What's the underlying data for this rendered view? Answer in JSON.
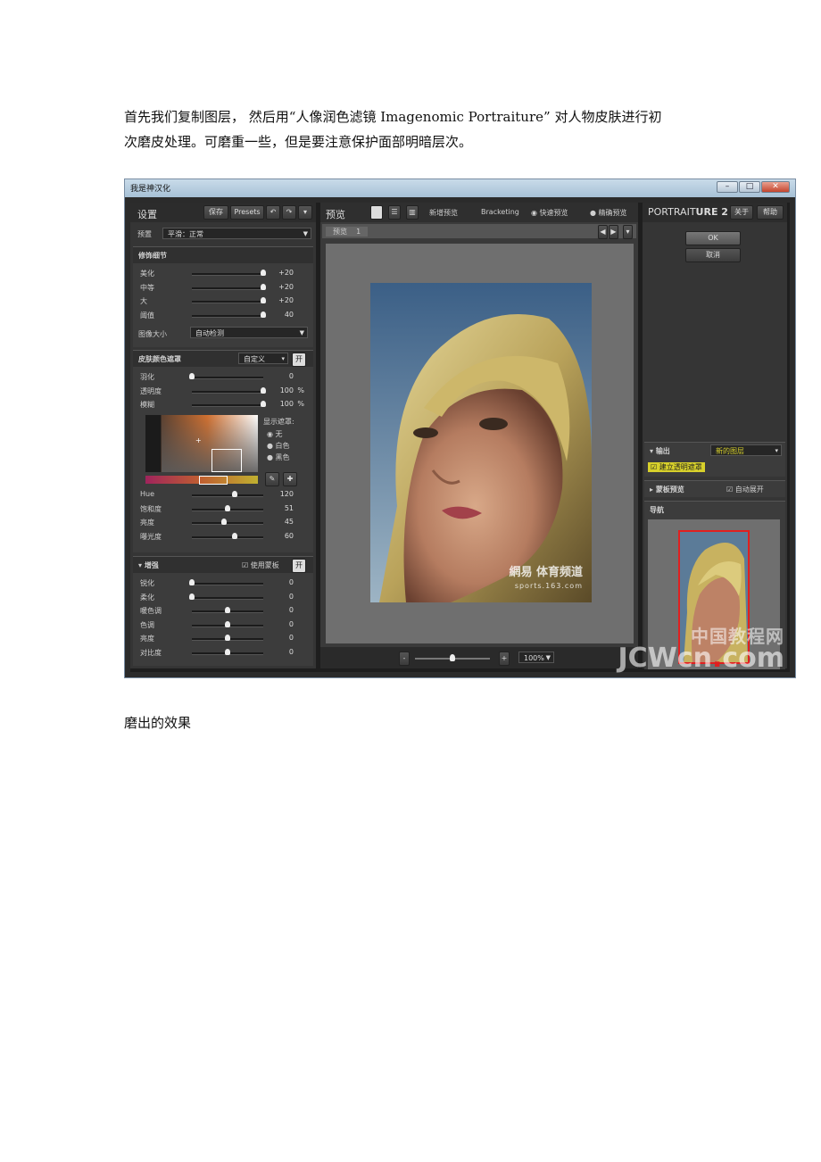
{
  "intro": {
    "line1": "首先我们复制图层， 然后用“人像润色滤镜 Imagenomic Portraiture” 对人物皮肤进行初",
    "line2": "次磨皮处理。可磨重一些，但是要注意保护面部明暗层次。"
  },
  "caption": "磨出的效果",
  "window": {
    "title": "我是神汉化",
    "controls": {
      "minimize": "–",
      "maximize": "□",
      "close": "✕"
    }
  },
  "settings": {
    "title": "设置",
    "save": "保存",
    "presets": "Presets",
    "undo_icon": "undo-icon",
    "redo_icon": "redo-icon",
    "preset_label": "预置",
    "preset_value": "平滑：正常",
    "detail": {
      "title": "修饰细节",
      "rows": [
        {
          "name": "美化",
          "value": "+20",
          "pos": 1.0
        },
        {
          "name": "中等",
          "value": "+20",
          "pos": 1.0
        },
        {
          "name": "大",
          "value": "+20",
          "pos": 1.0
        },
        {
          "name": "阈值",
          "value": "40",
          "pos": 1.0
        }
      ],
      "size_label": "图像大小",
      "size_value": "自动检测"
    },
    "skin": {
      "title": "皮肤颜色遮罩",
      "mode": "自定义",
      "toggle": "开",
      "rows": [
        {
          "name": "羽化",
          "value": "0",
          "unit": "",
          "pos": 0.0
        },
        {
          "name": "透明度",
          "value": "100",
          "unit": "%",
          "pos": 1.0
        },
        {
          "name": "模糊",
          "value": "100",
          "unit": "%",
          "pos": 1.0
        }
      ],
      "show_mask_label": "显示遮罩:",
      "mask_options": [
        "无",
        "白色",
        "黑色"
      ],
      "mask_selected": "无",
      "hsl_rows": [
        {
          "name": "Hue",
          "value": "120",
          "pos": 0.6
        },
        {
          "name": "饱和度",
          "value": "51",
          "pos": 0.5
        },
        {
          "name": "亮度",
          "value": "45",
          "pos": 0.45
        },
        {
          "name": "曝光度",
          "value": "60",
          "pos": 0.6
        }
      ],
      "eyedropper_icon": "eyedropper-icon",
      "eyedropper_plus_icon": "eyedropper-plus-icon"
    },
    "enhance": {
      "title": "增强",
      "use_mask": "使用蒙板",
      "toggle": "开",
      "rows": [
        {
          "name": "锐化",
          "value": "0",
          "pos": 0.0
        },
        {
          "name": "柔化",
          "value": "0",
          "pos": 0.0
        },
        {
          "name": "暖色调",
          "value": "0",
          "pos": 0.5
        },
        {
          "name": "色调",
          "value": "0",
          "pos": 0.5
        },
        {
          "name": "亮度",
          "value": "0",
          "pos": 0.5
        },
        {
          "name": "对比度",
          "value": "0",
          "pos": 0.5
        }
      ]
    }
  },
  "preview": {
    "title": "预览",
    "new_preview": "新增预览",
    "bracketing": "Bracketing",
    "fast_preview": "快速预览",
    "accurate_preview": "精确预览",
    "tab": "预览",
    "tab_num": "1",
    "watermark_cn": "網易 体育频道",
    "watermark_url": "sports.163.com",
    "zoom_minus": "-",
    "zoom_plus": "+",
    "zoom_value": "100%",
    "zoom_level": 0.5
  },
  "right": {
    "logo_a": "PORTRAIT",
    "logo_b": "URE 2",
    "about": "关于",
    "help": "帮助",
    "ok": "OK",
    "cancel": "取消",
    "output_label": "输出",
    "output_value": "新的图层",
    "transparent_mask": "建立透明遮罩",
    "mask_preview": "蒙板预览",
    "auto_open": "自动展开",
    "navigator": "导航"
  },
  "site_watermark": {
    "cn": "中国教程网",
    "en_a": "JCWcn",
    "en_dot": ".",
    "en_b": "com"
  },
  "colors": {
    "accent_yellow": "#d7d02b",
    "nav_box": "#e02020",
    "panel_bg": "#353535"
  }
}
